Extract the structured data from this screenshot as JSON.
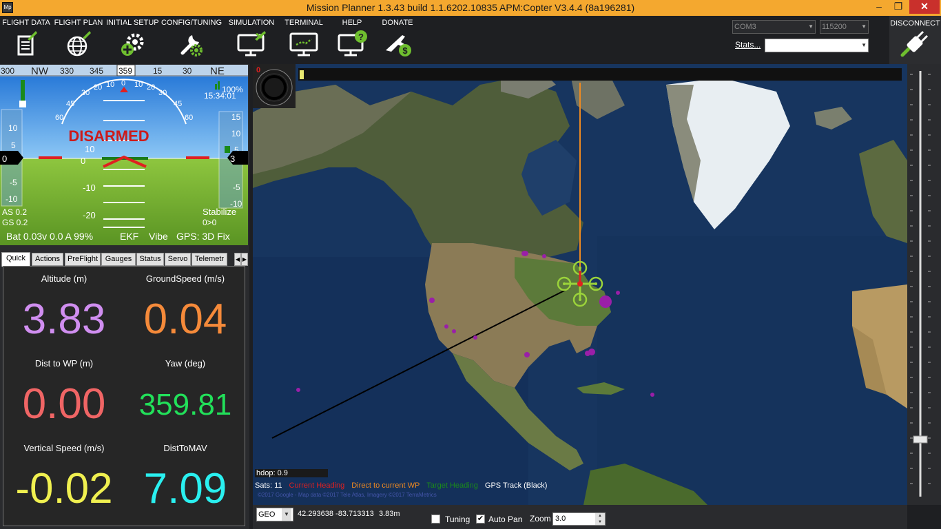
{
  "window": {
    "title": "Mission Planner 1.3.43 build 1.1.6202.10835 APM:Copter V3.4.4 (8a196281)",
    "app_icon": "Mp",
    "minimize": "–",
    "restore": "❐",
    "close": "✕"
  },
  "menu": {
    "items": [
      {
        "label": "FLIGHT DATA",
        "icon": "flight-data-icon"
      },
      {
        "label": "FLIGHT PLAN",
        "icon": "flight-plan-icon"
      },
      {
        "label": "INITIAL SETUP",
        "icon": "initial-setup-icon"
      },
      {
        "label": "CONFIG/TUNING",
        "icon": "config-tuning-icon"
      },
      {
        "label": "SIMULATION",
        "icon": "simulation-icon"
      },
      {
        "label": "TERMINAL",
        "icon": "terminal-icon"
      },
      {
        "label": "HELP",
        "icon": "help-icon"
      },
      {
        "label": "DONATE",
        "icon": "donate-icon"
      }
    ]
  },
  "connection": {
    "port": "COM3",
    "baud": "115200",
    "stats_label": "Stats...",
    "stats_value": "",
    "disconnect_label": "DISCONNECT"
  },
  "hud": {
    "heading_ticks": [
      "300",
      "NW",
      "330",
      "345",
      "359",
      "15",
      "30",
      "NE"
    ],
    "heading_value": "359",
    "status": "DISARMED",
    "battery_percent": "100%",
    "time": "15:34:01",
    "speed_scale": [
      "10",
      "5",
      "0",
      "-5",
      "-10"
    ],
    "speed_value": "0",
    "alt_scale": [
      "15",
      "10",
      "5",
      "-5",
      "-10"
    ],
    "alt_value": "3",
    "pitch_labels": [
      "10",
      "0",
      "-10",
      "-20"
    ],
    "roll_labels": [
      "60",
      "45",
      "30",
      "20",
      "10",
      "0",
      "10",
      "20",
      "30",
      "45",
      "60"
    ],
    "airspeed": "AS 0.2",
    "groundspeed": "GS 0.2",
    "mode": "Stabilize",
    "wp_info": "0>0",
    "battery": "Bat 0.03v 0.0 A 99%",
    "ekf": "EKF",
    "vibe": "Vibe",
    "gps": "GPS: 3D Fix"
  },
  "tabs": [
    "Quick",
    "Actions",
    "PreFlight",
    "Gauges",
    "Status",
    "Servo",
    "Telemetr"
  ],
  "quick": [
    {
      "label": "Altitude (m)",
      "value": "3.83",
      "color": "#d08ef0"
    },
    {
      "label": "GroundSpeed (m/s)",
      "value": "0.04",
      "color": "#f58a3a"
    },
    {
      "label": "Dist to WP (m)",
      "value": "0.00",
      "color": "#f06565"
    },
    {
      "label": "Yaw (deg)",
      "value": "359.81",
      "color": "#22e05a"
    },
    {
      "label": "Vertical Speed (m/s)",
      "value": "-0.02",
      "color": "#f0f050"
    },
    {
      "label": "DistToMAV",
      "value": "7.09",
      "color": "#2af0f0"
    }
  ],
  "map": {
    "top_number": "0",
    "hdop": "hdop: 0.9",
    "sats": "Sats: 11",
    "legend": {
      "current_heading": "Current Heading",
      "direct_wp": "Direct to current WP",
      "target_heading": "Target Heading",
      "gps_track": "GPS Track (Black)"
    },
    "copyright": "©2017 Google - Map data ©2017 Tele Atlas, Imagery ©2017 TerraMetrics",
    "colors": {
      "current": "#e02020",
      "direct": "#f08a20",
      "target": "#1a8a1a"
    }
  },
  "mapbar": {
    "coord_system": "GEO",
    "coords": "42.293638 -83.713313",
    "altitude": "3.83m",
    "tuning_label": "Tuning",
    "tuning_checked": false,
    "autopan_label": "Auto Pan",
    "autopan_checked": true,
    "zoom_label": "Zoom",
    "zoom_value": "3.0"
  }
}
